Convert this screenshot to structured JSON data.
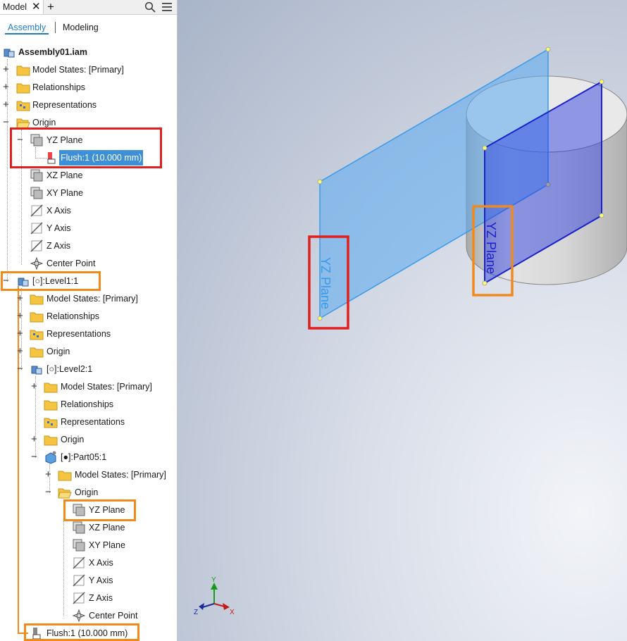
{
  "tabs": {
    "model": "Model",
    "close": "✕",
    "add": "+"
  },
  "subtabs": {
    "assembly": "Assembly",
    "modeling": "Modeling"
  },
  "tree": {
    "root": "Assembly01.iam",
    "r1": "Model States: [Primary]",
    "r2": "Relationships",
    "r3": "Representations",
    "r4": "Origin",
    "r5": "YZ Plane",
    "r6": "Flush:1 (10.000 mm)",
    "r7": "XZ Plane",
    "r8": "XY Plane",
    "r9": "X Axis",
    "r10": "Y Axis",
    "r11": "Z Axis",
    "r12": "Center Point",
    "r13": "[○]:Level1:1",
    "r14": "Model States: [Primary]",
    "r15": "Relationships",
    "r16": "Representations",
    "r17": "Origin",
    "r18": "[○]:Level2:1",
    "r19": "Model States: [Primary]",
    "r20": "Relationships",
    "r21": "Representations",
    "r22": "Origin",
    "r23": "[●]:Part05:1",
    "r24": "Model States: [Primary]",
    "r25": "Origin",
    "r26": "YZ Plane",
    "r27": "XZ Plane",
    "r28": "XY Plane",
    "r29": "X Axis",
    "r30": "Y Axis",
    "r31": "Z Axis",
    "r32": "Center Point",
    "r33": "Flush:1 (10.000 mm)"
  },
  "viewport": {
    "plane1_label": "YZ Plane",
    "plane2_label": "YZ Plane",
    "axis_x": "X",
    "axis_y": "Y",
    "axis_z": "Z"
  },
  "colors": {
    "highlight_red": "#e01f1f",
    "highlight_orange": "#f08a1c",
    "selection": "#3d8fd8",
    "plane_light_blue": "#5aaaf0",
    "plane_dark_blue": "#2233dd"
  }
}
